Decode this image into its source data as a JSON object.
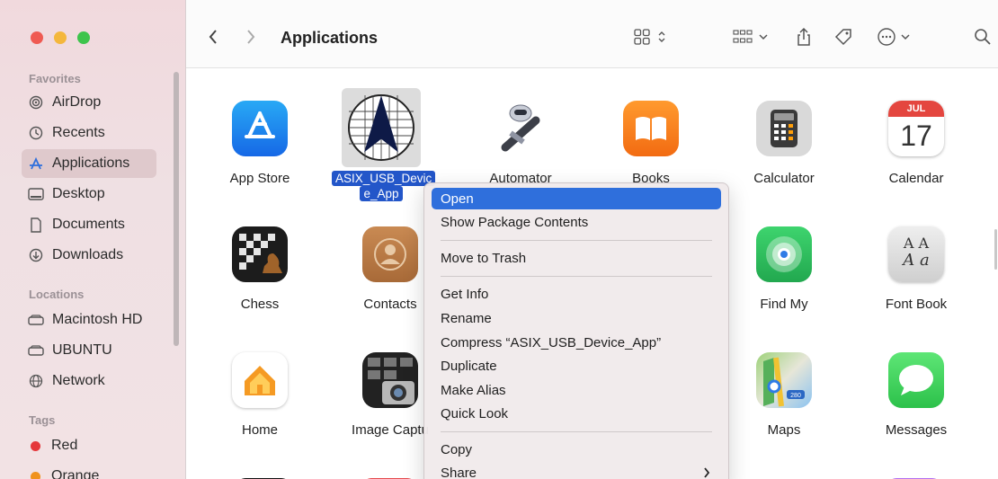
{
  "window": {
    "title": "Applications"
  },
  "sidebar": {
    "favorites_label": "Favorites",
    "favorites": [
      {
        "label": "AirDrop",
        "icon": "airdrop-icon"
      },
      {
        "label": "Recents",
        "icon": "clock-icon"
      },
      {
        "label": "Applications",
        "icon": "applications-icon",
        "selected": true
      },
      {
        "label": "Desktop",
        "icon": "desktop-icon"
      },
      {
        "label": "Documents",
        "icon": "document-icon"
      },
      {
        "label": "Downloads",
        "icon": "download-icon"
      }
    ],
    "locations_label": "Locations",
    "locations": [
      {
        "label": "Macintosh HD",
        "icon": "drive-icon"
      },
      {
        "label": "UBUNTU",
        "icon": "drive-icon"
      },
      {
        "label": "Network",
        "icon": "network-icon"
      }
    ],
    "tags_label": "Tags",
    "tags": [
      {
        "label": "Red",
        "color": "#e5383b"
      },
      {
        "label": "Orange",
        "color": "#f0921e"
      }
    ]
  },
  "apps": [
    {
      "label": "App Store"
    },
    {
      "label_line1": "ASIX_USB_Devic",
      "label_line2": "e_App"
    },
    {
      "label": "Automator"
    },
    {
      "label": "Books"
    },
    {
      "label": "Calculator"
    },
    {
      "label": "Calendar",
      "month": "JUL",
      "day": "17"
    },
    {
      "label": "Chess"
    },
    {
      "label": "Contacts"
    },
    {
      "label": "Find My"
    },
    {
      "label": "Font Book",
      "glyphs_top": "A A",
      "glyphs_bottom": "A a"
    },
    {
      "label": "Home"
    },
    {
      "label": "Image Captu"
    },
    {
      "label": "Maps",
      "badge": "280"
    },
    {
      "label": "Messages"
    }
  ],
  "context_menu": {
    "items": [
      {
        "label": "Open",
        "highlighted": true
      },
      {
        "label": "Show Package Contents"
      },
      {
        "label": "Move to Trash"
      },
      {
        "label": "Get Info"
      },
      {
        "label": "Rename"
      },
      {
        "label": "Compress “ASIX_USB_Device_App”"
      },
      {
        "label": "Duplicate"
      },
      {
        "label": "Make Alias"
      },
      {
        "label": "Quick Look"
      },
      {
        "label": "Copy"
      },
      {
        "label": "Share",
        "submenu": true
      }
    ]
  },
  "colors": {
    "accent": "#2f6fdc",
    "selection": "#2356c9"
  }
}
